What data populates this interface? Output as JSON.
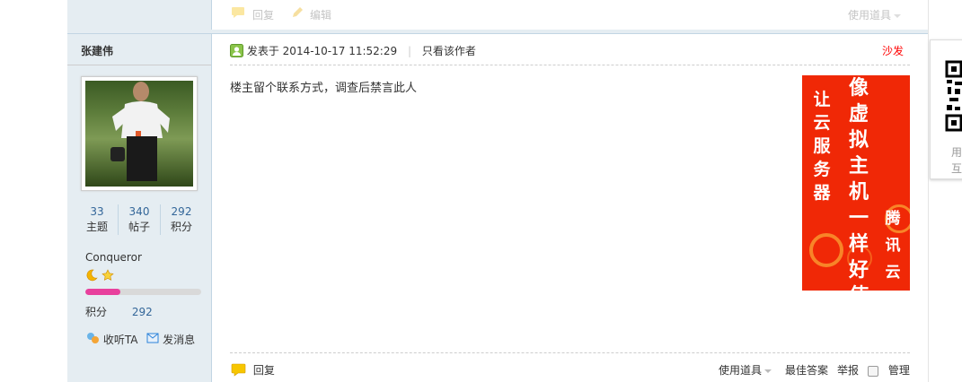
{
  "top_actions": {
    "reply": "回复",
    "edit": "编辑",
    "use_tools": "使用道具"
  },
  "author": {
    "name": "张建伟",
    "stats": [
      {
        "value": "33",
        "label": "主题"
      },
      {
        "value": "340",
        "label": "帖子"
      },
      {
        "value": "292",
        "label": "积分"
      }
    ],
    "rank": "Conqueror",
    "progress": 0.3,
    "points_label": "积分",
    "points_value": "292",
    "follow": "收听TA",
    "message": "发消息"
  },
  "post": {
    "posted_prefix": "发表于",
    "datetime": "2014-10-17 11:52:29",
    "author_only": "只看该作者",
    "floor": "沙发",
    "content": "楼主留个联系方式，调查后禁言此人"
  },
  "ad": {
    "col1": "让云服务器",
    "col2": "像虚拟主机一样好使",
    "col3": "腾讯云",
    "bg_color": "#f02806"
  },
  "footer": {
    "reply": "回复",
    "use_tools": "使用道具",
    "best_answer": "最佳答案",
    "report": "举报",
    "manage": "管理"
  },
  "right_panel": {
    "line1": "用",
    "line2": "互"
  }
}
